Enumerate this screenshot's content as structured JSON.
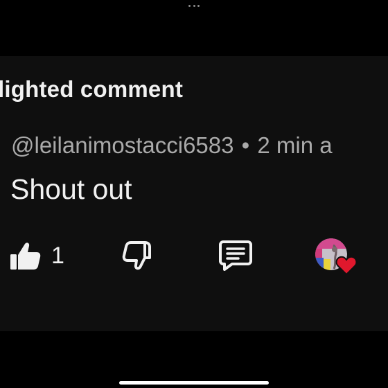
{
  "section": {
    "title": "lighted comment"
  },
  "comment": {
    "author": "@leilanimostacci6583",
    "separator": "•",
    "time": "2 min a",
    "text": "Shout out",
    "like_count": "1"
  },
  "icons": {
    "like": "thumbs-up-icon",
    "dislike": "thumbs-down-icon",
    "reply": "reply-comment-icon",
    "creator_heart": "creator-heart-icon"
  },
  "colors": {
    "background": "#000000",
    "panel": "#0f0f0f",
    "primary_text": "#f1f1f1",
    "secondary_text": "#aaaaaa",
    "heart": "#e0182d"
  }
}
